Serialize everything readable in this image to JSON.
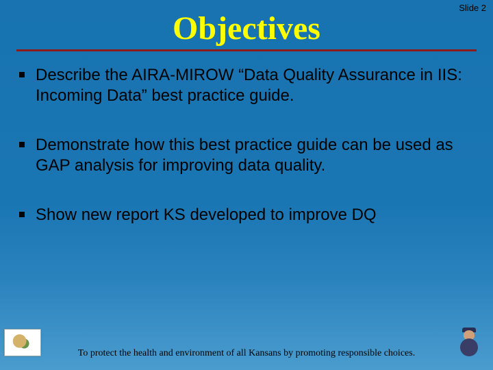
{
  "slide_number": "Slide 2",
  "title": "Objectives",
  "bullets": [
    "Describe the AIRA-MIROW “Data Quality Assurance in IIS: Incoming Data” best practice guide.",
    "Demonstrate how this best practice guide can be used as GAP analysis for improving data quality.",
    "Show new report KS developed to improve DQ"
  ],
  "footer_tagline": "To protect the health and environment of all Kansans by promoting responsible choices.",
  "logos": {
    "left": "kansas-seal-icon",
    "right": "mascot-icon"
  }
}
